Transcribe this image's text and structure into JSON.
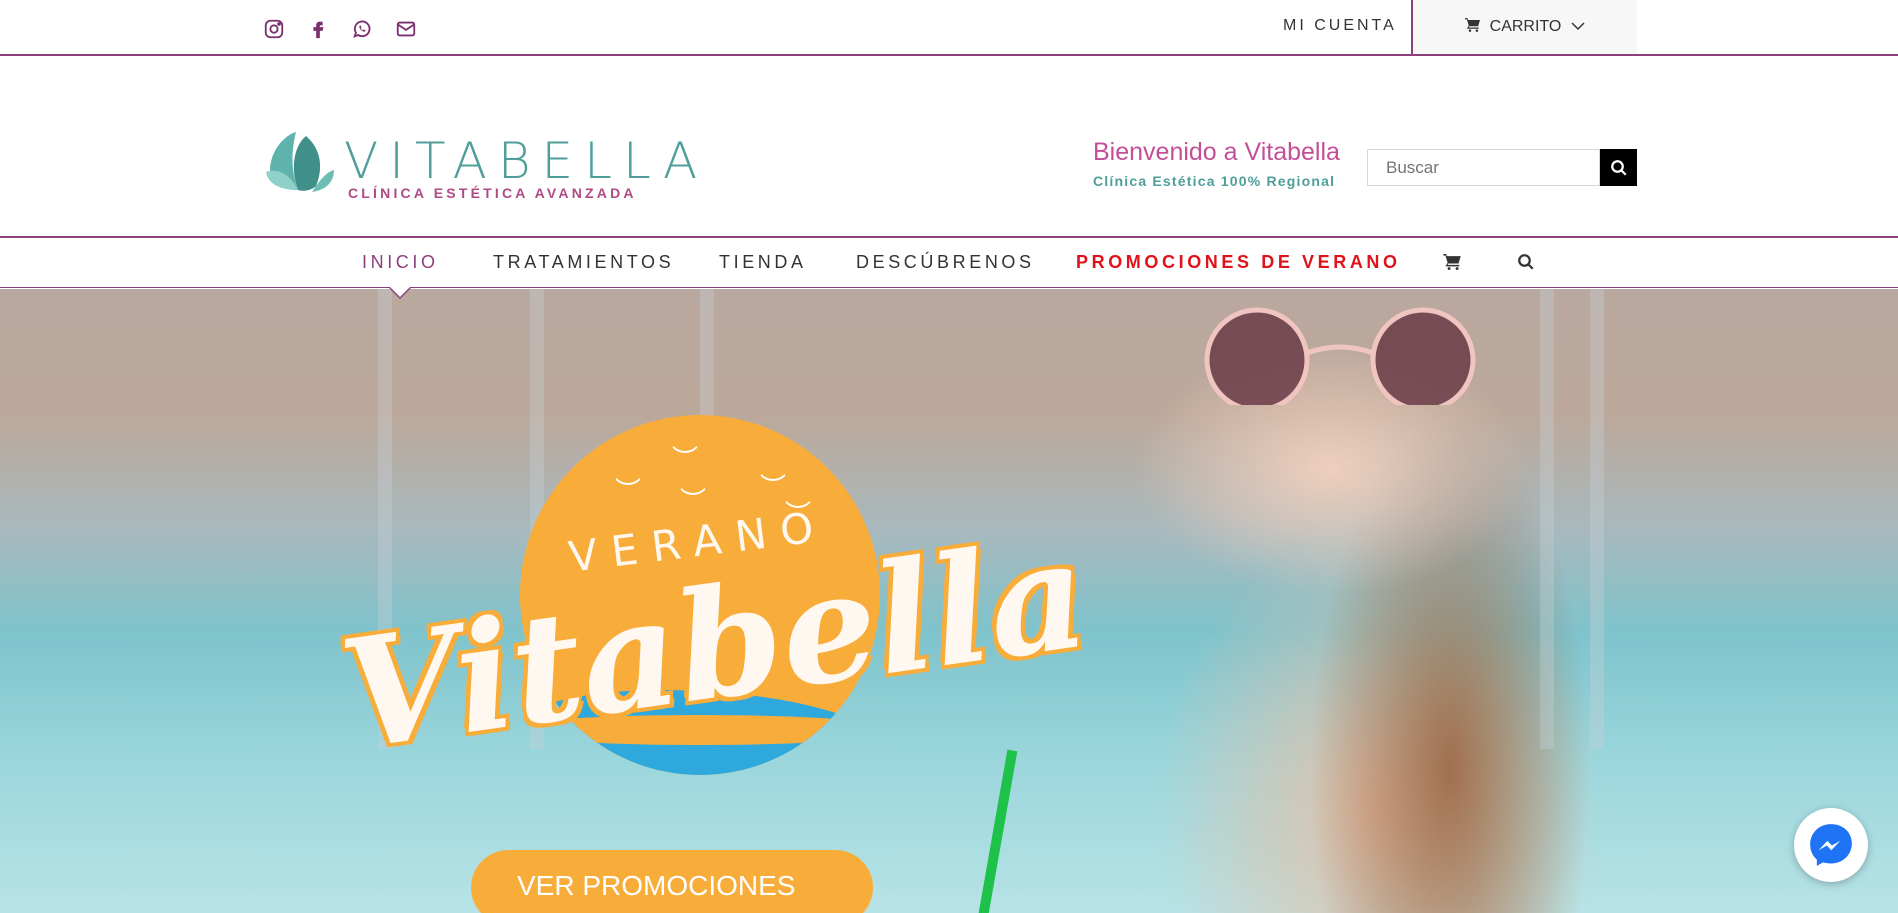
{
  "topbar": {
    "social": [
      "instagram-icon",
      "facebook-icon",
      "whatsapp-icon",
      "email-icon"
    ],
    "account_label": "MI CUENTA",
    "cart_label": "CARRITO"
  },
  "header": {
    "logo": {
      "brand": "VITABELLA",
      "tagline": "CLÍNICA ESTÉTICA AVANZADA"
    },
    "welcome_title": "Bienvenido a Vitabella",
    "welcome_subtitle": "Clínica Estética 100% Regional",
    "search_placeholder": "Buscar"
  },
  "nav": {
    "items": [
      {
        "label": "INICIO",
        "active": true
      },
      {
        "label": "TRATAMIENTOS"
      },
      {
        "label": "TIENDA"
      },
      {
        "label": "DESCÚBRENOS"
      },
      {
        "label": "PROMOCIONES DE VERANO",
        "highlight": true
      }
    ],
    "icons": [
      "cart-icon",
      "search-icon"
    ]
  },
  "hero": {
    "verano_text": "VERANO",
    "script_text": "Vitabella",
    "cta_label": "VER PROMOCIONES"
  },
  "colors": {
    "accent": "#8c3f7d",
    "teal": "#4e9e9a",
    "promo_red": "#e0121b",
    "sun_orange": "#f8ad3a",
    "wave_blue": "#2fa8dd"
  }
}
